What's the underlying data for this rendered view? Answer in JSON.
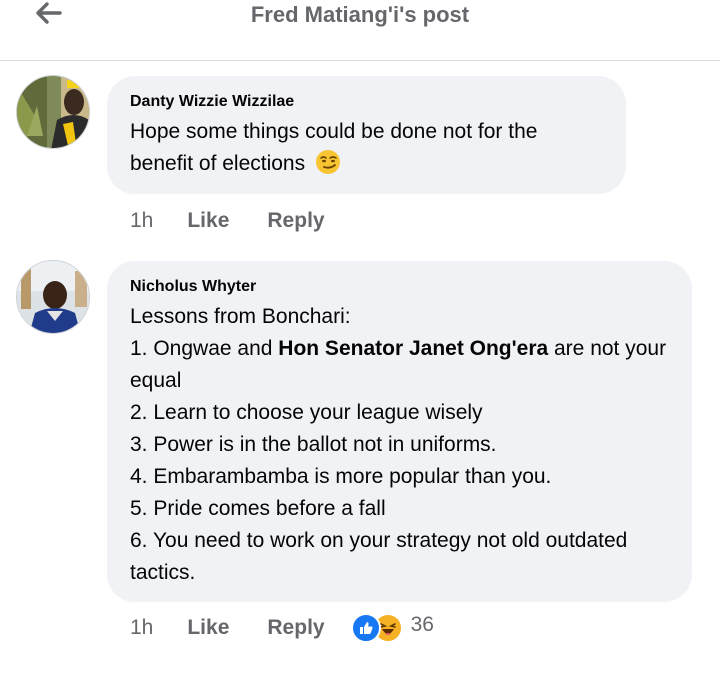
{
  "header": {
    "title": "Fred Matiang'i's post",
    "back_icon": "back-arrow-icon"
  },
  "comments": [
    {
      "author": "Danty Wizzie Wizzilae",
      "text": "Hope some things could be done not for the benefit of elections",
      "emoji": "smirking-face-emoji",
      "time": "1h",
      "like_label": "Like",
      "reply_label": "Reply"
    },
    {
      "author": "Nicholus Whyter",
      "lines": {
        "l0": "Lessons from Bonchari:",
        "l1_pre": "1. Ongwae and ",
        "l1_bold": "Hon Senator Janet Ong'era",
        "l1_post": " are not your equal",
        "l2": "2. Learn to choose your league wisely",
        "l3": "3. Power is in the ballot not in uniforms.",
        "l4": "4. Embarambamba is more popular than you.",
        "l5": "5. Pride comes before a fall",
        "l6": "6. You need to work on your strategy not old outdated tactics."
      },
      "time": "1h",
      "like_label": "Like",
      "reply_label": "Reply",
      "reactions": [
        "like-reaction-icon",
        "haha-reaction-icon"
      ],
      "reaction_count": "36"
    }
  ],
  "colors": {
    "like_blue": "#1877f2",
    "haha_yellow": "#f7b125",
    "muted_text": "#65676b",
    "bubble_bg": "#f0f2f5"
  }
}
